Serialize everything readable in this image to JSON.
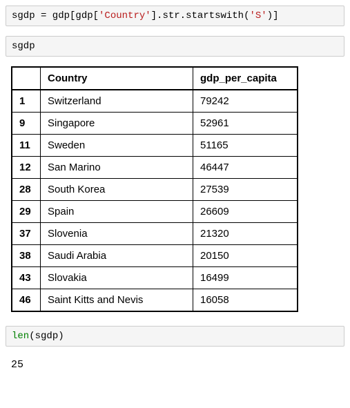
{
  "cell1": {
    "pre1": "sgdp = gdp[gdp[",
    "str1": "'Country'",
    "mid1": "].str.startswith(",
    "str2": "'S'",
    "post1": ")]"
  },
  "cell2": {
    "code": "sgdp"
  },
  "table": {
    "columns": [
      "Country",
      "gdp_per_capita"
    ],
    "rows": [
      {
        "idx": "1",
        "country": "Switzerland",
        "gdp": "79242"
      },
      {
        "idx": "9",
        "country": "Singapore",
        "gdp": "52961"
      },
      {
        "idx": "11",
        "country": "Sweden",
        "gdp": "51165"
      },
      {
        "idx": "12",
        "country": "San Marino",
        "gdp": "46447"
      },
      {
        "idx": "28",
        "country": "South Korea",
        "gdp": "27539"
      },
      {
        "idx": "29",
        "country": "Spain",
        "gdp": "26609"
      },
      {
        "idx": "37",
        "country": "Slovenia",
        "gdp": "21320"
      },
      {
        "idx": "38",
        "country": "Saudi Arabia",
        "gdp": "20150"
      },
      {
        "idx": "43",
        "country": "Slovakia",
        "gdp": "16499"
      },
      {
        "idx": "46",
        "country": "Saint Kitts and Nevis",
        "gdp": "16058"
      }
    ]
  },
  "cell3": {
    "fn": "len",
    "arg": "(sgdp)"
  },
  "output3": "25"
}
